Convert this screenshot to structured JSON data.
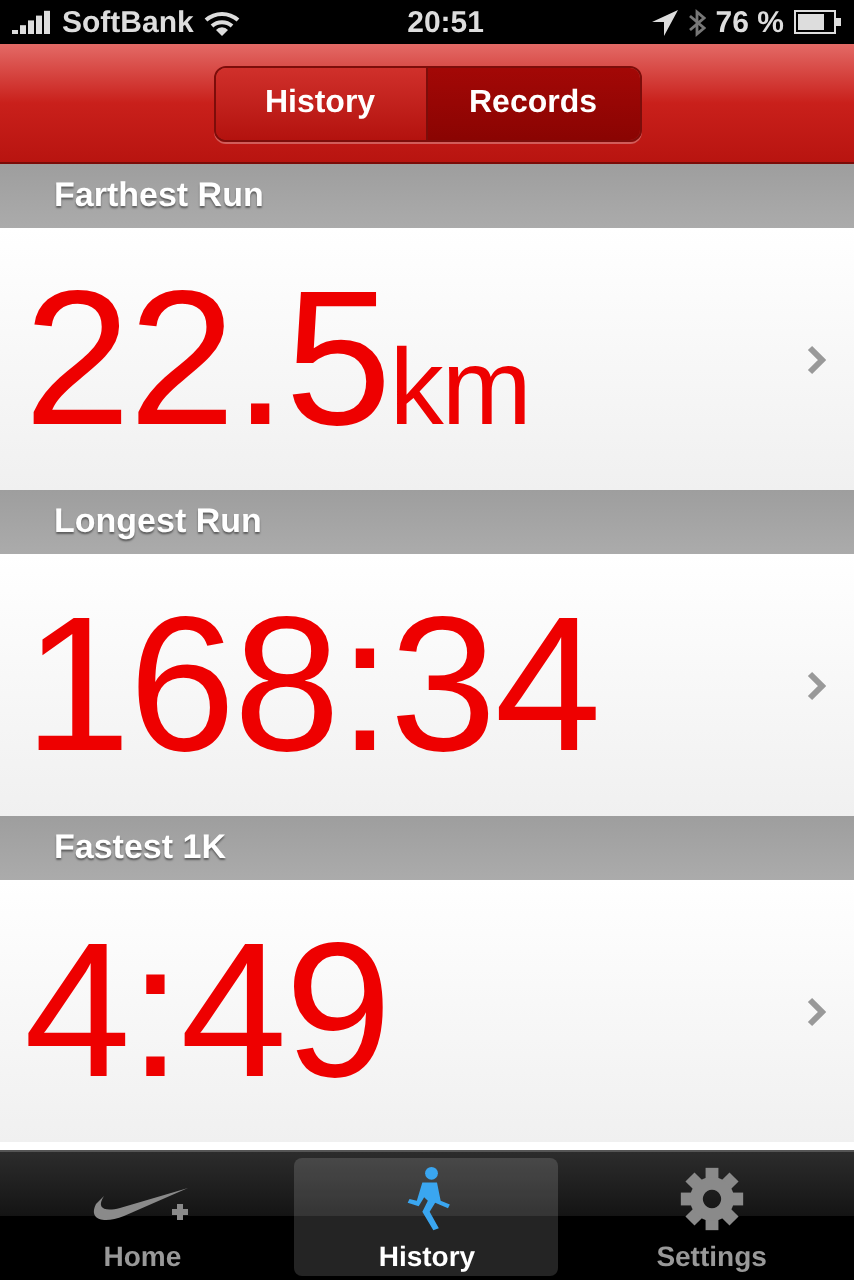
{
  "status_bar": {
    "carrier": "SoftBank",
    "time": "20:51",
    "battery": "76 %"
  },
  "segments": [
    {
      "label": "History",
      "selected": false
    },
    {
      "label": "Records",
      "selected": true
    }
  ],
  "records": [
    {
      "title": "Farthest Run",
      "value": "22.5",
      "unit": "km"
    },
    {
      "title": "Longest Run",
      "value": "168:34"
    },
    {
      "title": "Fastest 1K",
      "value": "4:49"
    }
  ],
  "tab_bar": [
    {
      "label": "Home",
      "kind": "home",
      "selected": false
    },
    {
      "label": "History",
      "kind": "history",
      "selected": true
    },
    {
      "label": "Settings",
      "kind": "settings",
      "selected": false
    }
  ]
}
